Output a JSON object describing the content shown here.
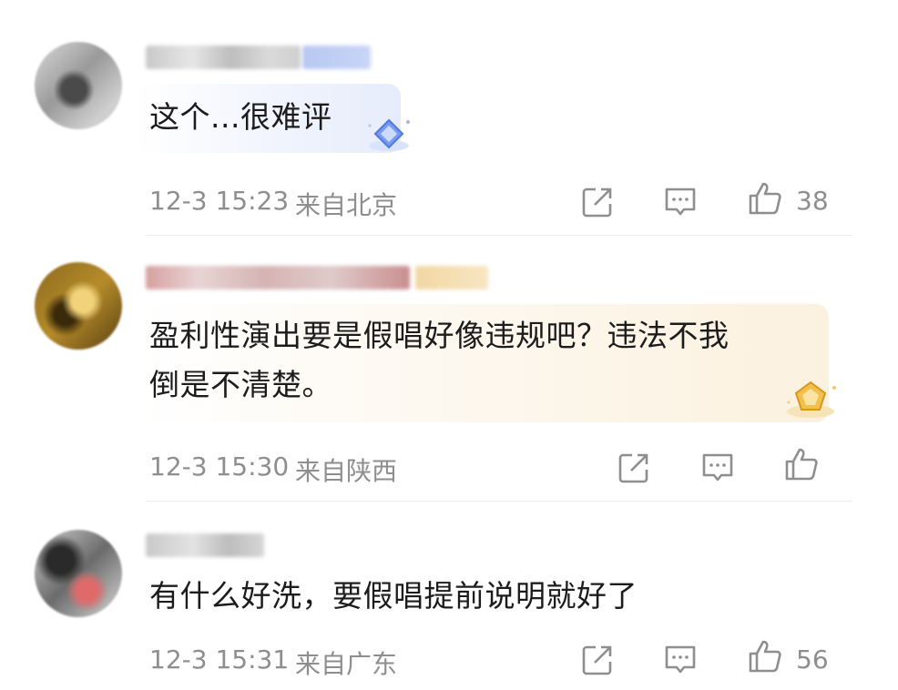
{
  "comments": [
    {
      "text": "这个...很难评",
      "time": "12-3 15:23",
      "location": "来自北京",
      "likes": "38"
    },
    {
      "text_line1": "盈利性演出要是假唱好像违规吧？违法不我",
      "text_line2": "倒是不清楚。",
      "time": "12-3 15:30",
      "location": "来自陕西",
      "likes": ""
    },
    {
      "text": "有什么好洗，要假唱提前说明就好了",
      "time": "12-3 15:31",
      "location": "来自广东",
      "likes": "56"
    }
  ],
  "icons": {
    "share": "share-icon",
    "comment": "comment-icon",
    "like": "thumbs-up-icon",
    "badge_blue": "diamond-badge-icon",
    "badge_gold": "gold-badge-icon"
  },
  "colors": {
    "meta": "#8e8e8e",
    "text": "#1c1c1c",
    "bubble_blue": "#e6ecfb",
    "bubble_gold": "#fbf1df"
  }
}
